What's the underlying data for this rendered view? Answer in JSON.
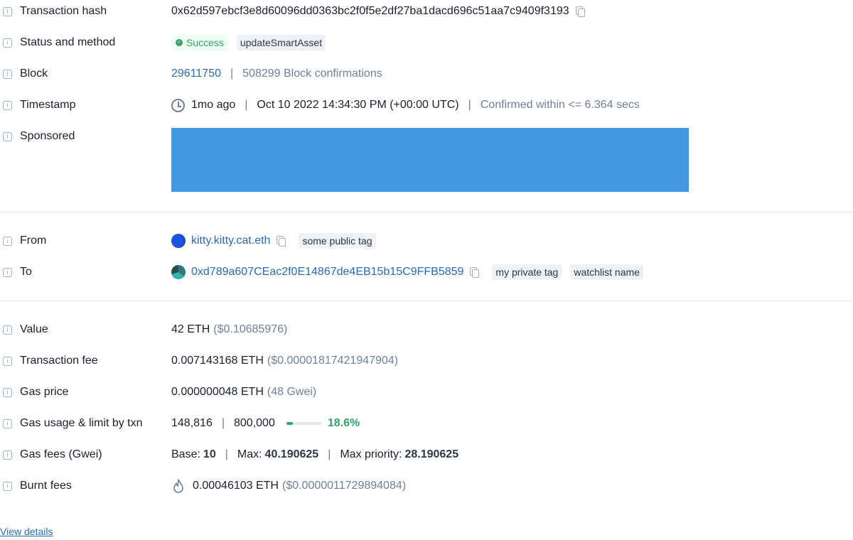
{
  "rows": {
    "tx_hash": {
      "label": "Transaction hash",
      "value": "0x62d597ebcf3e8d60096dd0363bc2f0f5e2df27ba1dacd696c51aa7c9409f3193"
    },
    "status": {
      "label": "Status and method",
      "status": "Success",
      "method": "updateSmartAsset"
    },
    "block": {
      "label": "Block",
      "number": "29611750",
      "confirmations": "508299 Block confirmations"
    },
    "timestamp": {
      "label": "Timestamp",
      "relative": "1mo ago",
      "absolute": "Oct 10 2022 14:34:30 PM (+00:00 UTC)",
      "confirmed": "Confirmed within <= 6.364 secs"
    },
    "sponsored": {
      "label": "Sponsored"
    },
    "from": {
      "label": "From",
      "address": "kitty.kitty.cat.eth",
      "tag": "some public tag"
    },
    "to": {
      "label": "To",
      "address": "0xd789a607CEac2f0E14867de4EB15b15C9FFB5859",
      "tags": [
        "my private tag",
        "watchlist name"
      ]
    },
    "value": {
      "label": "Value",
      "amount": "42 ETH",
      "usd": "($0.10685976)"
    },
    "fee": {
      "label": "Transaction fee",
      "amount": "0.007143168 ETH",
      "usd": "($0.00001817421947904)"
    },
    "gas_price": {
      "label": "Gas price",
      "amount": "0.000000048 ETH",
      "gwei": "(48 Gwei)"
    },
    "gas_usage": {
      "label": "Gas usage & limit by txn",
      "used": "148,816",
      "limit": "800,000",
      "percent_label": "18.6%",
      "percent": 18.6
    },
    "gas_fees": {
      "label": "Gas fees (Gwei)",
      "base_label": "Base:",
      "base": "10",
      "max_label": "Max:",
      "max": "40.190625",
      "priority_label": "Max priority:",
      "priority": "28.190625"
    },
    "burnt": {
      "label": "Burnt fees",
      "amount": "0.00046103 ETH",
      "usd": "($0.0000011729894084)"
    }
  },
  "view_details": "View details",
  "colors": {
    "link": "#2b6cb0",
    "success": "#38a169",
    "sponsored": "#4299e1",
    "muted": "#718096"
  },
  "icons": [
    "info-icon",
    "copy-icon",
    "clock-icon",
    "check-circle-icon",
    "fire-icon"
  ]
}
